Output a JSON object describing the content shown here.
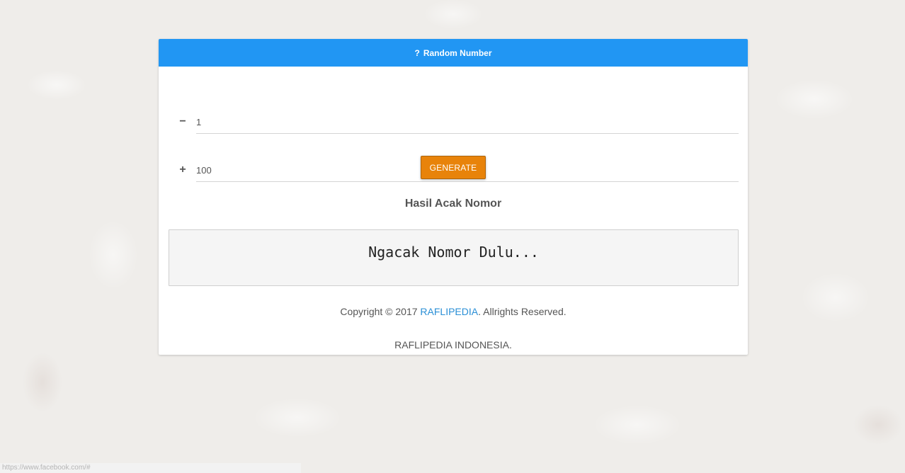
{
  "header": {
    "icon": "question-icon",
    "icon_glyph": "?",
    "title": "Random Number"
  },
  "min_field": {
    "icon": "minus-icon",
    "icon_glyph": "−",
    "value": "1"
  },
  "max_field": {
    "icon": "plus-icon",
    "icon_glyph": "+",
    "value": "100"
  },
  "generate_label": "GENERATE",
  "result": {
    "title": "Hasil Acak Nomor",
    "text": "Ngacak Nomor Dulu..."
  },
  "footer": {
    "copyright_prefix": "Copyright © 2017 ",
    "brand_link": "RAFLIPEDIA",
    "copyright_suffix": ". Allrights Reserved.",
    "company": "RAFLIPEDIA INDONESIA."
  },
  "status_bar_url": "https://www.facebook.com/#",
  "colors": {
    "header": "#2196f3",
    "button": "#e8830a",
    "link": "#2a8fd6"
  }
}
